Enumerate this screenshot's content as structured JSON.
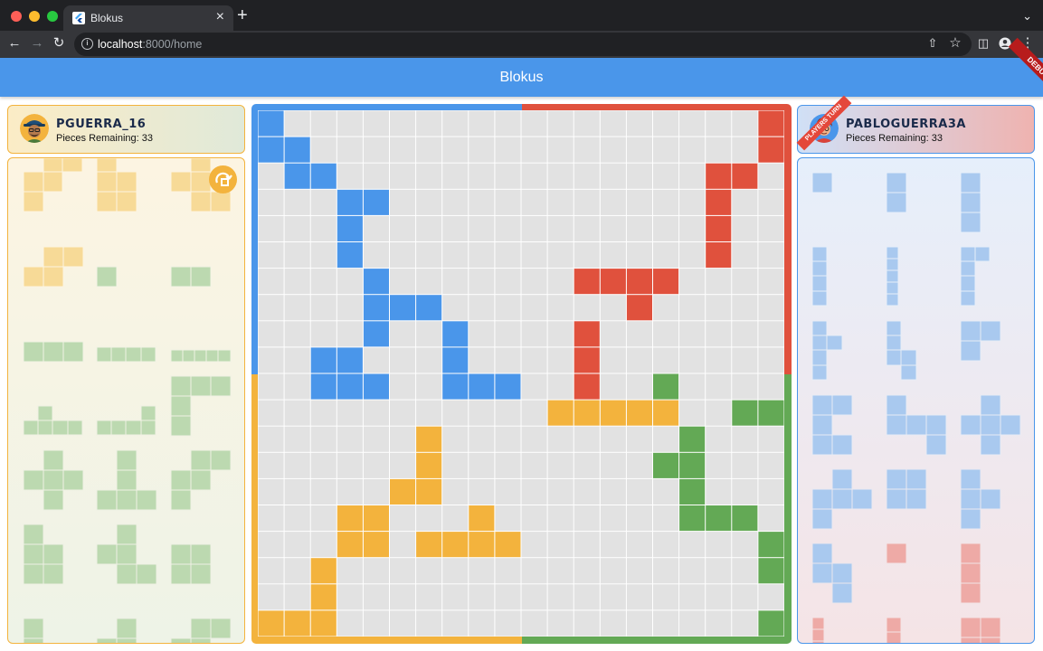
{
  "browser": {
    "tab_title": "Blokus",
    "tab_close": "×",
    "new_tab": "+",
    "url_host": "localhost",
    "url_rest": ":8000/home"
  },
  "app": {
    "title": "Blokus",
    "debug_label": "DEBUG"
  },
  "players": {
    "left": {
      "name": "PGUERRA_16",
      "pieces_remaining": "Pieces Remaining: 33",
      "accent": "#f3b33d"
    },
    "right": {
      "name": "PABLOGUERRA3A",
      "pieces_remaining": "Pieces Remaining: 33",
      "accent": "#4a96ea",
      "turn_label": "PLAYERS TURN"
    }
  },
  "colors": {
    "blue": "#4a96ea",
    "red": "#e0513d",
    "yellow": "#f3b33d",
    "green": "#63a955",
    "empty": "#e2e2e2"
  },
  "board": {
    "size": 20,
    "rows": [
      "B..................R",
      "BB.................R",
      ".BB..............RR.",
      "...BB............R..",
      "...B.............R..",
      "...B.............R..",
      "....B.......RRRR....",
      "....BBB.......R.....",
      "....B..B....R.......",
      "..BB...B....R.......",
      "..BBB..BBB..R..G....",
      "...........YYYYY..GGGG..",
      "......Y.........G...",
      "......Y........GG...",
      ".....YY.........G...",
      "...YY...Y.......GGG.",
      "...YY.YYYY.........G",
      "..Y................GG",
      "..Y.................G",
      "YYY................GG"
    ]
  }
}
